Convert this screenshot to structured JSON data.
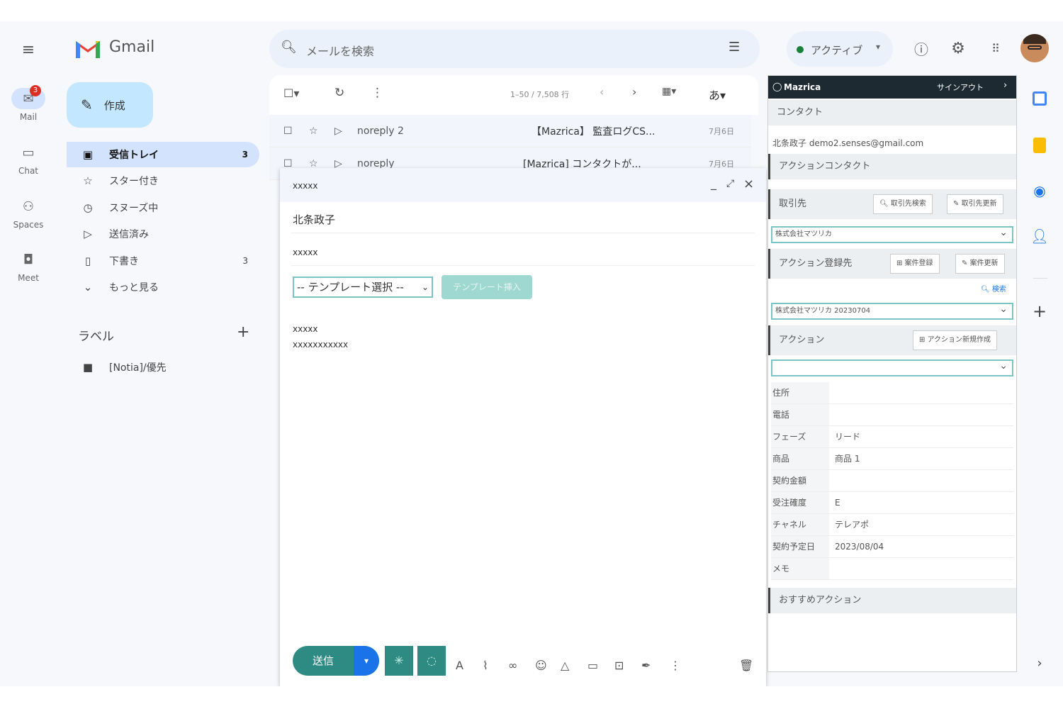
{
  "header": {
    "brand": "Gmail",
    "search_placeholder": "メールを検索",
    "status": "アクティブ"
  },
  "rail": [
    {
      "label": "Mail",
      "badge": "3"
    },
    {
      "label": "Chat"
    },
    {
      "label": "Spaces"
    },
    {
      "label": "Meet"
    }
  ],
  "compose_btn": "作成",
  "nav": [
    {
      "label": "受信トレイ",
      "count": "3"
    },
    {
      "label": "スター付き",
      "count": ""
    },
    {
      "label": "スヌーズ中",
      "count": ""
    },
    {
      "label": "送信済み",
      "count": ""
    },
    {
      "label": "下書き",
      "count": "3"
    },
    {
      "label": "もっと見る",
      "count": ""
    }
  ],
  "labels": {
    "title": "ラベル",
    "items": [
      "[Notia]/優先"
    ]
  },
  "toolbar": {
    "pager": "1–50 / 7,508 行",
    "input_tool": "あ"
  },
  "emails": [
    {
      "sender": "noreply 2",
      "subject": "【Mazrica】 監査ログCS...",
      "date": "7月6日"
    },
    {
      "sender": "noreply",
      "subject": "[Mazrica] コンタクトが...",
      "date": "7月6日"
    }
  ],
  "compose": {
    "title": "xxxxx",
    "to": "北条政子",
    "subject": "xxxxx",
    "template_select": "-- テンプレート選択 --",
    "template_insert": "テンプレート挿入",
    "body_line1": "xxxxx",
    "body_line2": "xxxxxxxxxxx",
    "send": "送信"
  },
  "side": {
    "brand": "Mazrica",
    "signout": "サインアウト",
    "contact_title": "コンタクト",
    "contact_value": "北条政子 demo2.senses@gmail.com",
    "action_contact": "アクションコンタクト",
    "client_label": "取引先",
    "client_search": "取引先検索",
    "client_update": "取引先更新",
    "client_value": "株式会社マツリカ",
    "dest_label": "アクション登録先",
    "dest_new": "案件登録",
    "dest_update": "案件更新",
    "search": "検索",
    "dest_value": "株式会社マツリカ 20230704",
    "action_label": "アクション",
    "action_new": "アクション新規作成",
    "fields": [
      {
        "label": "住所",
        "value": ""
      },
      {
        "label": "電話",
        "value": ""
      },
      {
        "label": "フェーズ",
        "value": "リード"
      },
      {
        "label": "商品",
        "value": "商品 1"
      },
      {
        "label": "契約金額",
        "value": ""
      },
      {
        "label": "受注確度",
        "value": "E"
      },
      {
        "label": "チャネル",
        "value": "テレアポ"
      },
      {
        "label": "契約予定日",
        "value": "2023/08/04"
      },
      {
        "label": "メモ",
        "value": ""
      }
    ],
    "recommend": "おすすめアクション"
  }
}
